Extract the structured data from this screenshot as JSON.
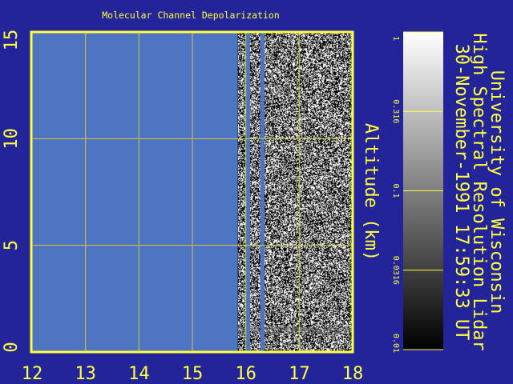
{
  "chart_data": {
    "type": "heatmap",
    "title": "Molecular Channel Depolarization",
    "xlabel": "",
    "ylabel": "Altitude (km)",
    "xlim": [
      12,
      18
    ],
    "ylim": [
      0,
      15
    ],
    "x_ticks": [
      "12",
      "13",
      "14",
      "15",
      "16",
      "17",
      "18"
    ],
    "y_ticks": [
      "0",
      "5",
      "10",
      "15"
    ],
    "x_tick_values": [
      12,
      13,
      14,
      15,
      16,
      17,
      18
    ],
    "y_tick_values": [
      0,
      5,
      10,
      15
    ],
    "grid": true,
    "no_data_region": {
      "x_start": 12,
      "x_end": 15.85
    },
    "no_data_stripes": [
      {
        "x_start": 16.0,
        "x_end": 16.08
      },
      {
        "x_start": 16.27,
        "x_end": 16.35
      }
    ],
    "noise_start_x": 15.85,
    "colorbar": {
      "scale": "log",
      "ticks": [
        "1",
        "0.316",
        "0.1",
        "0.0316",
        "0.01"
      ],
      "tick_values": [
        1,
        0.316,
        0.1,
        0.0316,
        0.01
      ],
      "range": [
        0.01,
        1
      ]
    }
  },
  "header": {
    "line1": "University of Wisconsin",
    "line2": "High Spectral Resolution Lidar",
    "line3": "30-November-1991 17:59:33 UT"
  },
  "colors": {
    "background": "#24249a",
    "no_data": "#4e74c2",
    "axis": "#ffff40",
    "grid": "#cccc44",
    "text": "#ffff40"
  }
}
